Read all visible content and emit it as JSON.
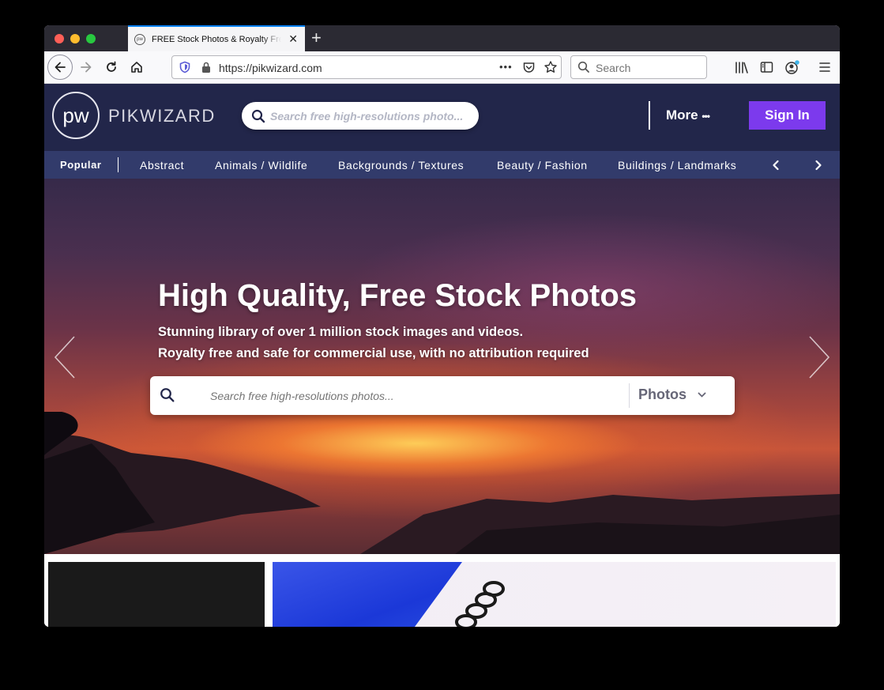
{
  "browser": {
    "tab_title": "FREE Stock Photos & Royalty Free",
    "tab_favicon": "pw",
    "new_tab_label": "+",
    "url": "https://pikwizard.com",
    "search_placeholder": "Search"
  },
  "header": {
    "logo_mark": "pw",
    "logo_text": "PIKWIZARD",
    "search_placeholder": "Search free high-resolutions photo...",
    "more_label": "More",
    "more_dots": "•••",
    "signin_label": "Sign In"
  },
  "categories": {
    "items": [
      "Popular",
      "Abstract",
      "Animals / Wildlife",
      "Backgrounds / Textures",
      "Beauty / Fashion",
      "Buildings / Landmarks"
    ]
  },
  "hero": {
    "title": "High Quality, Free Stock Photos",
    "subtitle_1": "Stunning library of over 1 million stock images and videos.",
    "subtitle_2": "Royalty free and safe for commercial use, with no attribution required",
    "search_placeholder": "Search free high-resolutions photos...",
    "search_type": "Photos"
  },
  "colors": {
    "header_bg": "#22264a",
    "category_bg": "#323b6b",
    "signin_bg": "#7c3aed",
    "tab_accent": "#0a84ff"
  }
}
